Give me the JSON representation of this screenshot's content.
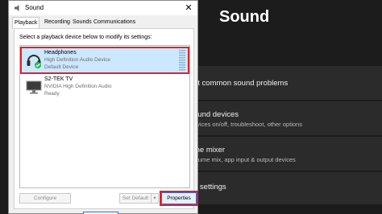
{
  "settings": {
    "title": "Sound",
    "cards": [
      {
        "title": "ot common sound problems",
        "subtitle": ""
      },
      {
        "title": "ound devices",
        "subtitle": "evices on/off, troubleshoot, other options"
      },
      {
        "title": "me mixer",
        "subtitle": "olume mix, app input & output devices"
      },
      {
        "title": "d settings",
        "subtitle": ""
      }
    ]
  },
  "dialog": {
    "title": "Sound",
    "tabs": [
      "Playback",
      "Recording",
      "Sounds",
      "Communications"
    ],
    "instruction": "Select a playback device below to modify its settings:",
    "devices": [
      {
        "name": "Headphones",
        "description": "High Definition Audio Device",
        "status": "Default Device",
        "icon": "headphones-icon"
      },
      {
        "name": "S2-TEK TV",
        "description": "NVIDIA High Definition Audio",
        "status": "Ready",
        "icon": "monitor-icon"
      }
    ],
    "buttons": {
      "configure": "Configure",
      "set_default": "Set Default",
      "properties": "Properties"
    }
  },
  "colors": {
    "highlight": "#e0202a",
    "selection": "#cce8ff"
  }
}
